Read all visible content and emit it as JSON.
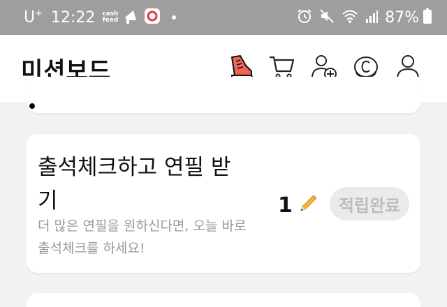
{
  "status_bar": {
    "carrier": "U",
    "carrier_sup": "+",
    "time": "12:22",
    "cashfeed_line1": "cash",
    "cashfeed_line2": "feed",
    "battery": "87%"
  },
  "header": {
    "title": "미션보드"
  },
  "mission": {
    "title": "출석체크하고 연필 받기",
    "description": "더 많은 연필을 원하신다면, 오늘 바로 출석체크를 하세요!",
    "reward_count": "1",
    "button_label": "적립완료"
  },
  "colors": {
    "status_bar_bg": "#9e9e9e",
    "page_bg": "#f2f2f2",
    "sneaker_accent": "#f0645a",
    "pencil": "#f4b63f",
    "button_bg": "#ebebeb",
    "button_text": "#bcbcbc"
  },
  "icons": [
    "sneaker-icon",
    "cart-icon",
    "add-friend-icon",
    "coin-icon",
    "profile-icon",
    "pencil-icon"
  ]
}
